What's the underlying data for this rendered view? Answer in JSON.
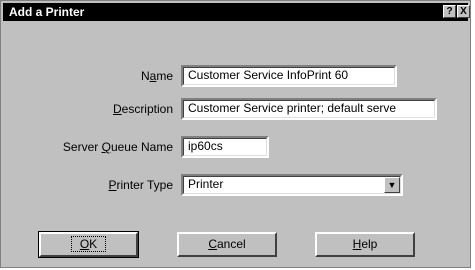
{
  "window": {
    "title": "Add a Printer",
    "help_glyph": "?",
    "close_glyph": "X"
  },
  "form": {
    "name": {
      "label_pre": "N",
      "label_ul": "a",
      "label_post": "me",
      "value": "Customer Service InfoPrint 60"
    },
    "description": {
      "label_pre": "",
      "label_ul": "D",
      "label_post": "escription",
      "value": "Customer Service printer; default serve"
    },
    "server_queue_name": {
      "label_pre": "Server ",
      "label_ul": "Q",
      "label_post": "ueue Name",
      "value": "ip60cs"
    },
    "printer_type": {
      "label_pre": "",
      "label_ul": "P",
      "label_post": "rinter Type",
      "value": "Printer",
      "arrow_glyph": "▼"
    }
  },
  "buttons": {
    "ok": {
      "label_pre": "",
      "label_ul": "O",
      "label_post": "K"
    },
    "cancel": {
      "label_pre": "",
      "label_ul": "C",
      "label_post": "ancel"
    },
    "help": {
      "label_pre": "",
      "label_ul": "H",
      "label_post": "elp"
    }
  }
}
